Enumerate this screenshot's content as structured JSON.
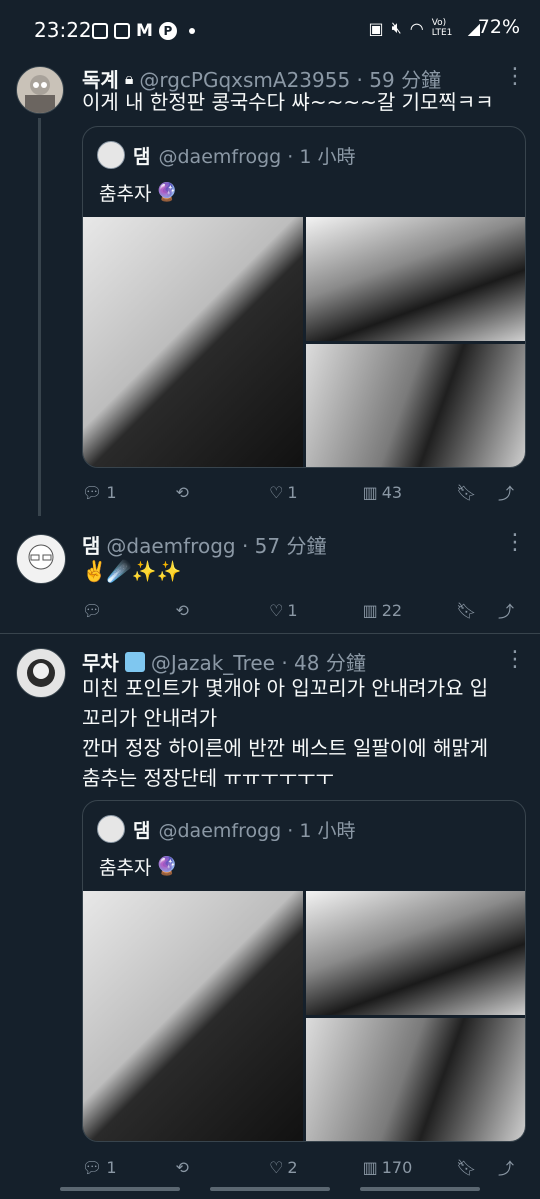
{
  "status_bar": {
    "time": "23:22",
    "network_label": "Vo) LTE1",
    "battery": "72%"
  },
  "tweets": [
    {
      "name": "독계",
      "handle": "@rgcPGqxsmA23955 · 59 分鐘",
      "text": "이게 내 한정판 콩국수다 쌰~~~~갈 기모찍ㅋㅋ",
      "quote": {
        "name": "댐",
        "handle": "@daemfrogg · 1 小時",
        "text": "춤추자"
      },
      "actions": {
        "replies": "1",
        "retweets": "",
        "likes": "1",
        "views": "43"
      }
    },
    {
      "name": "댐",
      "handle": "@daemfrogg · 57 分鐘",
      "text": "✌️☄️✨✨",
      "actions": {
        "replies": "",
        "retweets": "",
        "likes": "1",
        "views": "22"
      }
    },
    {
      "name": "무차",
      "handle": "@Jazak_Tree · 48 分鐘",
      "text_lines": [
        "미친 포인트가 몇개야 아 입꼬리가 안내려가요 입",
        "꼬리가 안내려가",
        "깐머 정장 하이른에 반깐 베스트 일팔이에 해맑게",
        "춤추는 정장단테 ㅠㅠㅜㅜㅜㅜ"
      ],
      "quote": {
        "name": "댐",
        "handle": "@daemfrogg · 1 小時",
        "text": "춤추자"
      },
      "actions": {
        "replies": "1",
        "retweets": "",
        "likes": "2",
        "views": "170"
      }
    }
  ],
  "colors": {
    "background": "#15202b",
    "text": "#f7f9f9",
    "muted": "#8b98a5",
    "border": "#38444d"
  }
}
